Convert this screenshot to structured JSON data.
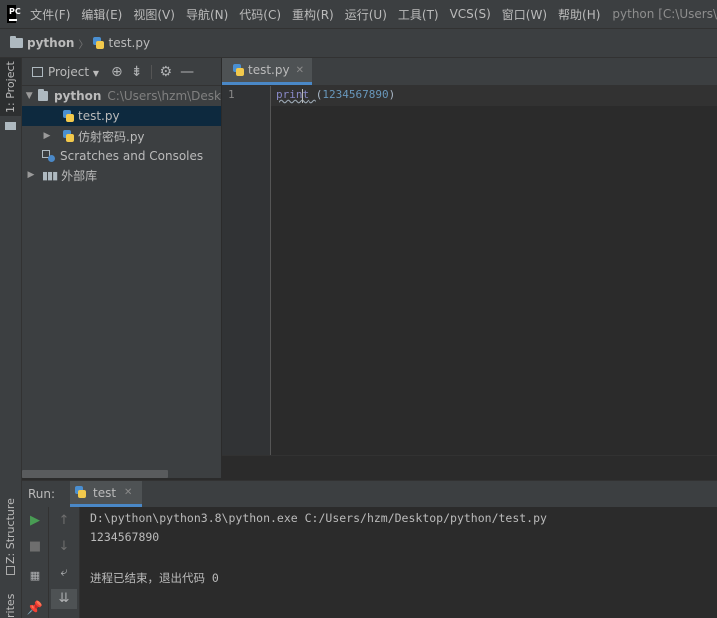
{
  "menubar": {
    "logo": "PC",
    "items": [
      "文件(F)",
      "编辑(E)",
      "视图(V)",
      "导航(N)",
      "代码(C)",
      "重构(R)",
      "运行(U)",
      "工具(T)",
      "VCS(S)",
      "窗口(W)",
      "帮助(H)"
    ],
    "window_title": "python [C:\\Users\\"
  },
  "navbar": {
    "project": "python",
    "file": "test.py"
  },
  "left_strip": {
    "project_tab": "1: Project",
    "structure_tab": "Z: Structure",
    "favorites_tab": "rites"
  },
  "project_panel": {
    "dropdown_label": "Project",
    "tree": {
      "root": "python",
      "root_path": "C:\\Users\\hzm\\Desk",
      "file1": "test.py",
      "file2": "仿射密码.py",
      "scratches": "Scratches and Consoles",
      "libraries": "外部库"
    }
  },
  "editor": {
    "tab_label": "test.py",
    "line_number": "1",
    "code": {
      "fn": "print",
      "arg": "1234567890"
    }
  },
  "run_panel": {
    "label": "Run:",
    "tab_label": "test",
    "console": {
      "line1": "D:\\python\\python3.8\\python.exe C:/Users/hzm/Desktop/python/test.py",
      "line2": "1234567890",
      "line3": "进程已结束，退出代码 0"
    }
  },
  "colors": {
    "accent": "#4a88c7",
    "selection": "#0d293e",
    "run_green": "#499c54"
  }
}
